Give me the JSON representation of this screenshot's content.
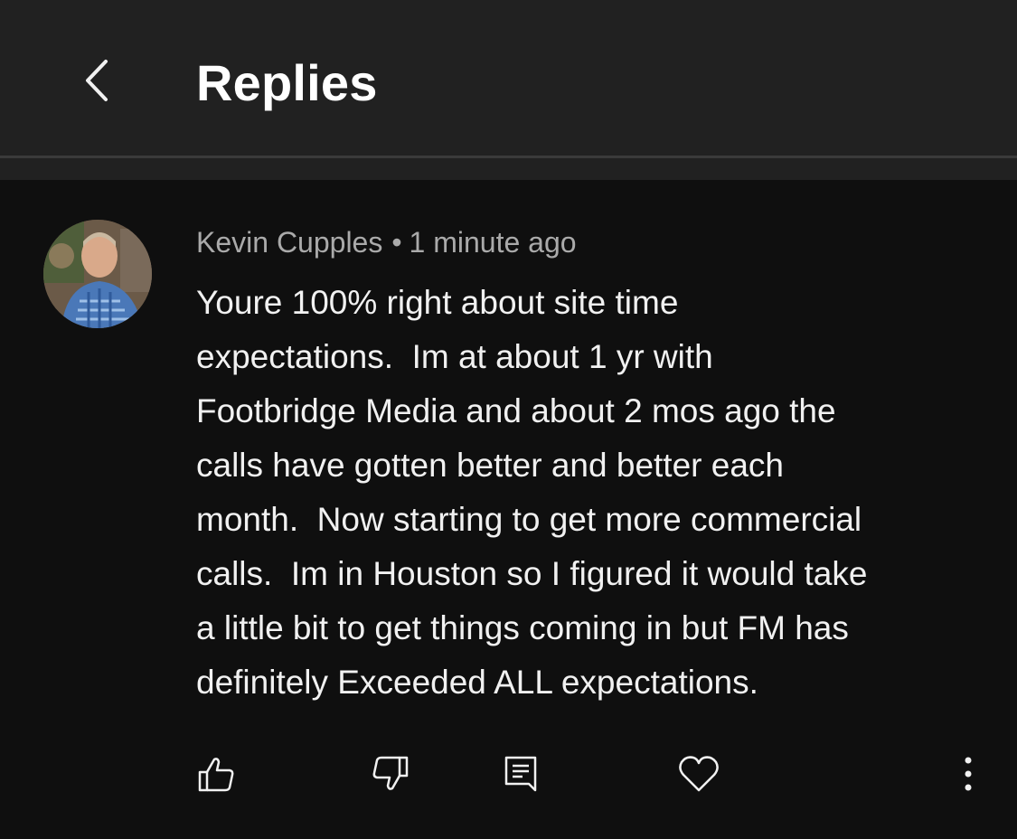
{
  "header": {
    "title": "Replies",
    "back_icon": "chevron-left-icon"
  },
  "comment": {
    "author": "Kevin Cupples",
    "separator": "•",
    "timestamp": "1 minute ago",
    "lines": [
      "Youre 100% right about site time",
      "expectations.  Im at about 1 yr with",
      "Footbridge Media and about 2 mos ago the",
      "calls have gotten better and better each",
      "month.  Now starting to get more commercial",
      "calls.  Im in Houston so I figured it would take",
      "a little bit to get things coming in but FM has",
      "definitely Exceeded ALL expectations."
    ],
    "actions": {
      "like_icon": "thumbs-up-icon",
      "dislike_icon": "thumbs-down-icon",
      "reply_icon": "comment-icon",
      "heart_icon": "heart-icon",
      "more_icon": "more-vertical-icon"
    }
  },
  "colors": {
    "background": "#0f0f0f",
    "header_background": "#212121",
    "text_primary": "#f1f1f1",
    "text_secondary": "#aaaaaa"
  }
}
